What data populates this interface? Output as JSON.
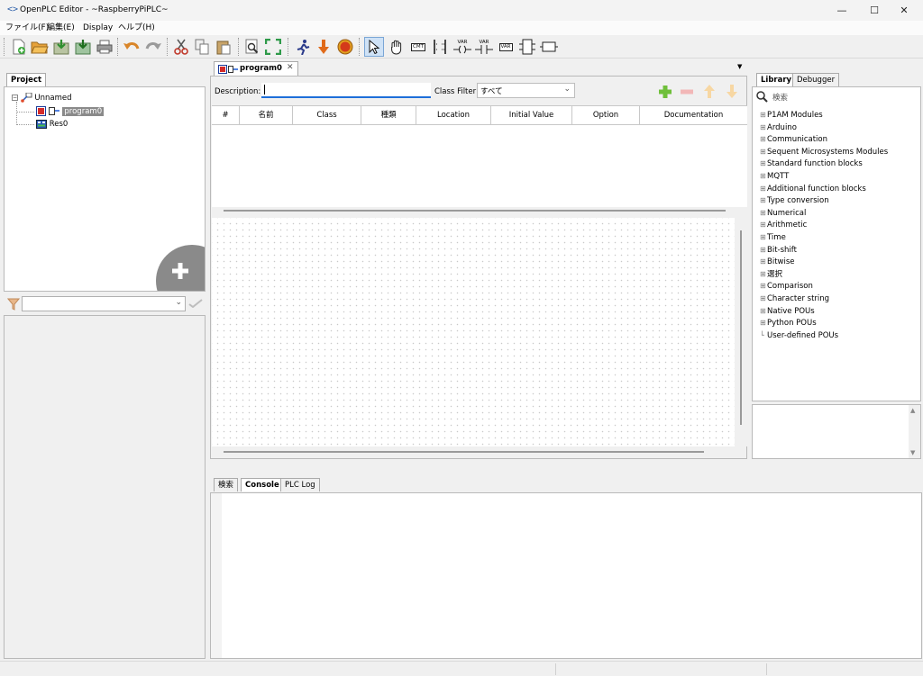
{
  "window": {
    "app_icon": "<>",
    "title": "OpenPLC Editor - ~RaspberryPiPLC~",
    "minimize": "—",
    "maximize": "☐",
    "close": "✕"
  },
  "menu": [
    "ファイル(F)",
    "編集(E)",
    "Display",
    "ヘルプ(H)"
  ],
  "toolbar": {
    "cmt_label": "CMT",
    "var_label": "VAR",
    "fb_label": "FB",
    "dc_label": "DC"
  },
  "project_panel": {
    "tab": "Project",
    "tree": [
      {
        "label": "Unnamed",
        "level": 0
      },
      {
        "label": "program0",
        "level": 1,
        "selected": true
      },
      {
        "label": "Res0",
        "level": 1
      }
    ],
    "add_icon": "plus-icon"
  },
  "editor": {
    "tab_label": "program0",
    "tab_close": "✕",
    "description_label": "Description:",
    "description_value": "",
    "class_filter_label": "Class Filter:",
    "class_filter_value": "すべて",
    "columns": [
      "#",
      "名前",
      "Class",
      "種類",
      "Location",
      "Initial Value",
      "Option",
      "Documentation"
    ]
  },
  "library_panel": {
    "tabs": [
      "Library",
      "Debugger"
    ],
    "search_placeholder": "検索",
    "items": [
      "P1AM Modules",
      "Arduino",
      "Communication",
      "Sequent Microsystems Modules",
      "Standard function blocks",
      "MQTT",
      "Additional function blocks",
      "Type conversion",
      "Numerical",
      "Arithmetic",
      "Time",
      "Bit-shift",
      "Bitwise",
      "選択",
      "Comparison",
      "Character string",
      "Native POUs",
      "Python POUs",
      "User-defined POUs"
    ]
  },
  "bottom_panel": {
    "tabs": [
      "検索",
      "Console",
      "PLC Log"
    ],
    "active_tab": "Console"
  },
  "colors": {
    "accent": "#1e6fd9",
    "selected_bg": "#8a8a8a",
    "grid_dot": "#c9c9c9"
  }
}
